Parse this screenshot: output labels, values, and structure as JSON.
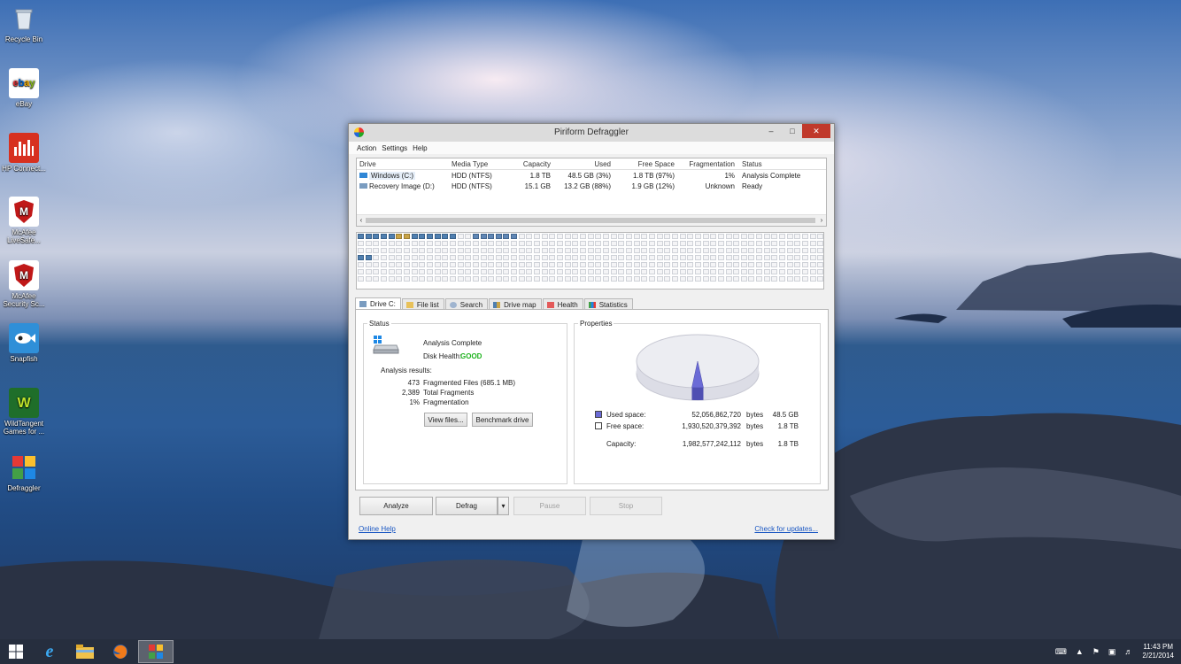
{
  "desktop": {
    "icons": [
      {
        "label": "Recycle Bin",
        "icon": "recycle-bin-icon"
      },
      {
        "label": "eBay",
        "icon": "ebay-icon"
      },
      {
        "label": "HP Connect...",
        "icon": "hp-connected-icon"
      },
      {
        "label": "McAfee LiveSafe...",
        "icon": "mcafee-livesafe-icon"
      },
      {
        "label": "McAfee Security Sc...",
        "icon": "mcafee-security-icon"
      },
      {
        "label": "Snapfish",
        "icon": "snapfish-icon"
      },
      {
        "label": "WildTangent Games for ...",
        "icon": "wildtangent-icon"
      },
      {
        "label": "Defraggler",
        "icon": "defraggler-icon"
      }
    ]
  },
  "window": {
    "title": "Piriform Defraggler",
    "menu": [
      "Action",
      "Settings",
      "Help"
    ]
  },
  "drives": {
    "columns": [
      "Drive",
      "Media Type",
      "Capacity",
      "Used",
      "Free Space",
      "Fragmentation",
      "Status"
    ],
    "rows": [
      {
        "drive": "Windows (C:)",
        "media": "HDD (NTFS)",
        "capacity": "1.8 TB",
        "used": "48.5 GB (3%)",
        "free": "1.8 TB (97%)",
        "frag": "1%",
        "status": "Analysis Complete"
      },
      {
        "drive": "Recovery Image (D:)",
        "media": "HDD (NTFS)",
        "capacity": "15.1 GB",
        "used": "13.2 GB (88%)",
        "free": "1.9 GB (12%)",
        "frag": "Unknown",
        "status": "Ready"
      }
    ]
  },
  "tabs": [
    "Drive C:",
    "File list",
    "Search",
    "Drive map",
    "Health",
    "Statistics"
  ],
  "status": {
    "title": "Status",
    "analysis": "Analysis Complete",
    "health_label": "Disk Health:",
    "health_value": "GOOD",
    "results_label": "Analysis results:",
    "results": [
      {
        "num": "473",
        "text": "Fragmented Files (685.1 MB)"
      },
      {
        "num": "2,389",
        "text": "Total Fragments"
      },
      {
        "num": "1%",
        "text": "Fragmentation"
      }
    ],
    "view_files": "View files...",
    "benchmark": "Benchmark drive"
  },
  "properties": {
    "title": "Properties",
    "used_label": "Used space:",
    "used_bytes": "52,056,862,720",
    "used_unit": "bytes",
    "used_human": "48.5 GB",
    "free_label": "Free space:",
    "free_bytes": "1,930,520,379,392",
    "free_unit": "bytes",
    "free_human": "1.8 TB",
    "cap_label": "Capacity:",
    "cap_bytes": "1,982,577,242,112",
    "cap_unit": "bytes",
    "cap_human": "1.8 TB",
    "used_fraction": 0.03,
    "used_color": "#6b6bd6",
    "free_color": "#ffffff"
  },
  "actions": {
    "analyze": "Analyze",
    "defrag": "Defrag",
    "pause": "Pause",
    "stop": "Stop",
    "online_help": "Online Help",
    "check_updates": "Check for updates..."
  },
  "taskbar": {
    "time": "11:43 PM",
    "date": "2/21/2014"
  }
}
